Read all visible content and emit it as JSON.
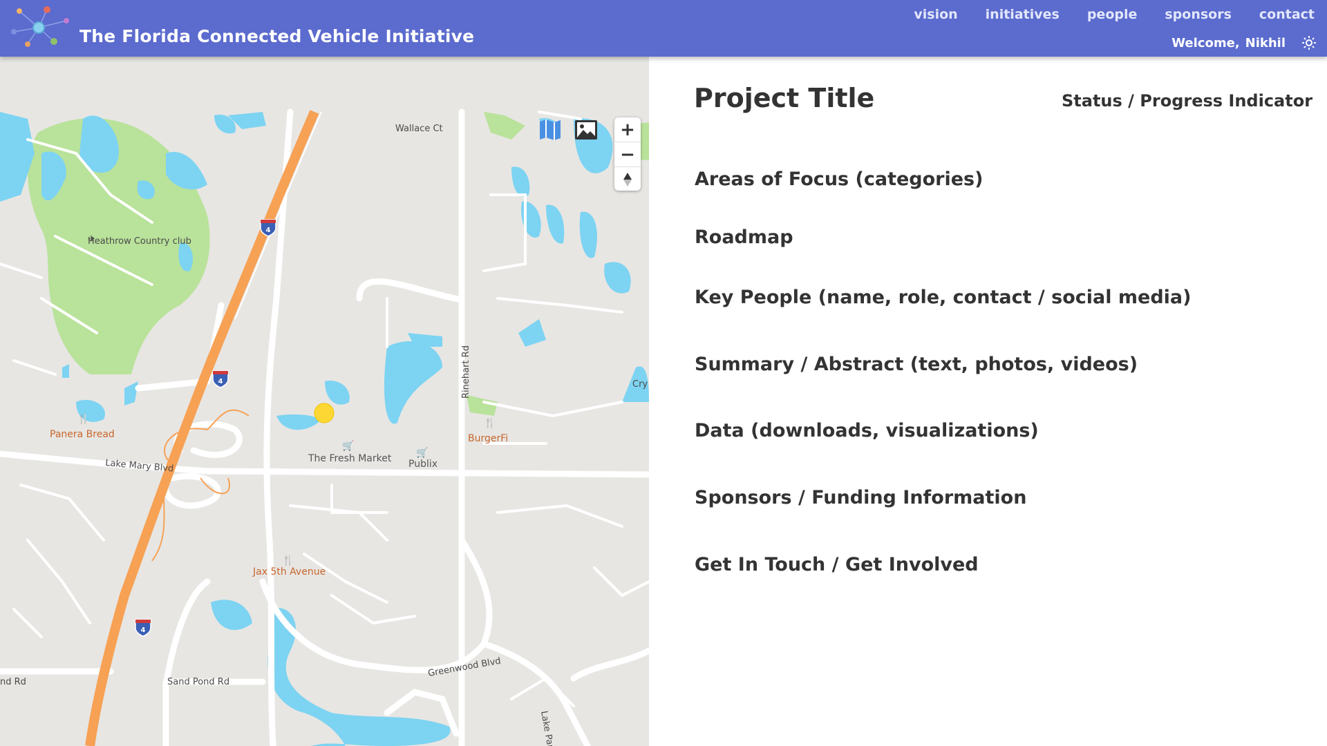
{
  "header": {
    "title": "The Florida Connected Vehicle Initiative",
    "nav": [
      "vision",
      "initiatives",
      "people",
      "sponsors",
      "contact"
    ],
    "welcome_label": "Welcome,",
    "user_name": "Nikhil",
    "settings_icon": "gear-icon",
    "logo_icon": "network-nodes-logo"
  },
  "map": {
    "roads": {
      "wallace": "Wallace Ct",
      "rinehart": "Rinehart Rd",
      "lake_mary": "Lake Mary Blvd",
      "greenwood": "Greenwood Blvd",
      "sand_pond": "Sand Pond Rd",
      "nd_rd": "nd Rd",
      "lake_par": "Lake Par",
      "cry": "Cry"
    },
    "places": {
      "country_club": "Heathrow Country club",
      "panera": "Panera Bread",
      "burgerfi": "BurgerFi",
      "fresh_market": "The Fresh Market",
      "publix": "Publix",
      "jax": "Jax 5th Avenue"
    },
    "highway_shield": "4",
    "controls": {
      "zoom_in": "+",
      "zoom_out": "−",
      "compass_icon": "compass-arrow-icon",
      "map_layer_icon": "map-layer-icon",
      "satellite_layer_icon": "satellite-image-icon"
    },
    "colors": {
      "water": "#7dd3f2",
      "park": "#b9e29a",
      "highway": "#f7a154",
      "marker": "#fdd835"
    }
  },
  "content": {
    "project_title": "Project Title",
    "status": "Status / Progress Indicator",
    "sections": [
      "Areas of Focus (categories)",
      "Roadmap",
      "Key People (name, role, contact / social media)",
      "Summary / Abstract (text, photos, videos)",
      "Data (downloads, visualizations)",
      "Sponsors / Funding Information",
      "Get In Touch / Get Involved"
    ]
  }
}
